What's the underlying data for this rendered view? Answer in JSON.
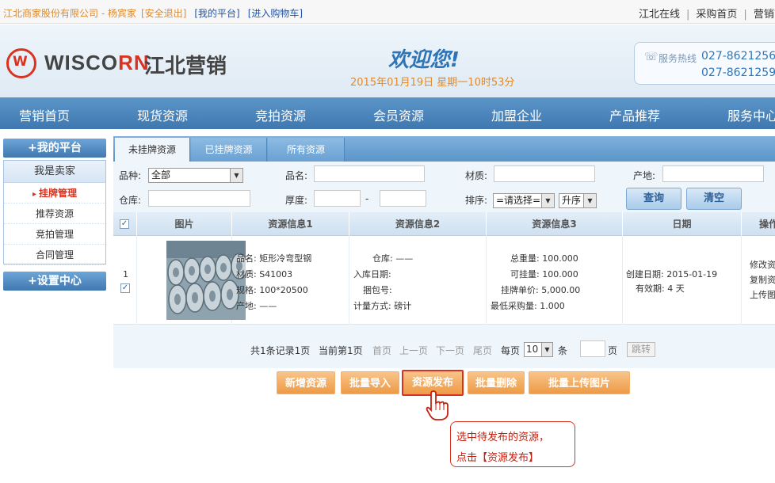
{
  "topbar": {
    "company": "江北商家股份有限公司 - 杨宾家",
    "logout": "[安全退出]",
    "my_platform": "[我的平台]",
    "cart": "[进入购物车]",
    "right_links": [
      "江北在线",
      "采购首页",
      "营销首"
    ]
  },
  "header": {
    "logo_text_a": "WISCO",
    "logo_text_b": "RN",
    "logo_cn": "江北营销",
    "welcome": "欢迎您!",
    "datetime": "2015年01月19日 星期一10时53分",
    "hotline_label": "服务热线",
    "hotline_1": "027-8621256",
    "hotline_2": "027-8621259"
  },
  "nav": [
    "营销首页",
    "现货资源",
    "竞拍资源",
    "会员资源",
    "加盟企业",
    "产品推荐",
    "服务中心"
  ],
  "sidebar": {
    "my_platform": "+我的平台",
    "seller": "我是卖家",
    "items": [
      "挂牌管理",
      "推荐资源",
      "竞拍管理",
      "合同管理"
    ],
    "settings": "+设置中心"
  },
  "tabs": [
    "未挂牌资源",
    "已挂牌资源",
    "所有资源"
  ],
  "filters": {
    "variety_label": "品种:",
    "variety_value": "全部",
    "name_label": "品名:",
    "material_label": "材质:",
    "origin_label": "产地:",
    "warehouse_label": "仓库:",
    "thickness_label": "厚度:",
    "thickness_sep": "-",
    "sort_label": "排序:",
    "sort_value": "=请选择=",
    "order_value": "升序",
    "query_btn": "查询",
    "clear_btn": "清空"
  },
  "table": {
    "headers": [
      "图片",
      "资源信息1",
      "资源信息2",
      "资源信息3",
      "日期",
      "操作"
    ],
    "row": {
      "index": "1",
      "info1": [
        "品名: 矩形冷弯型钢",
        "材质: S41003",
        "规格: 100*20500",
        "产地: ——"
      ],
      "info2": [
        "仓库: ——",
        "入库日期:",
        "捆包号:",
        "计量方式: 磅计"
      ],
      "info3": [
        "总重量: 100.000",
        "可挂量: 100.000",
        "挂牌单价: 5,000.00",
        "最低采购量: 1.000"
      ],
      "date": [
        "创建日期: 2015-01-19",
        "有效期: 4 天"
      ],
      "ops": [
        "修改资",
        "复制资",
        "上传图"
      ]
    }
  },
  "pager": {
    "total": "共1条记录1页",
    "current": "当前第1页",
    "first": "首页",
    "prev": "上一页",
    "next": "下一页",
    "last": "尾页",
    "per_page": "每页",
    "per_page_value": "10",
    "unit": "条",
    "page": "页",
    "jump": "跳转"
  },
  "actions": [
    "新增资源",
    "批量导入",
    "资源发布",
    "批量删除",
    "批量上传图片"
  ],
  "callout": {
    "line1": "选中待发布的资源，",
    "line2": "点击【资源发布】"
  }
}
